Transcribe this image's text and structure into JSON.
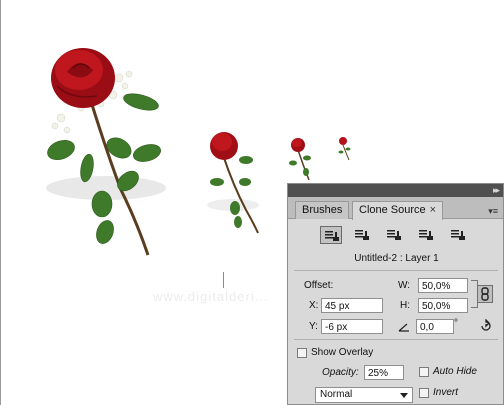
{
  "canvas": {
    "watermark": "www.digitalderi..."
  },
  "panel": {
    "tabs": [
      {
        "label": "Brushes",
        "active": false
      },
      {
        "label": "Clone Source",
        "active": true
      }
    ],
    "tab_close": "×",
    "collapse_glyph": "▸▸",
    "menu_glyph": "▾≡",
    "clone_sources": [
      "clone-source-1",
      "clone-source-2",
      "clone-source-3",
      "clone-source-4",
      "clone-source-5"
    ],
    "document_label": "Untitled-2 : Layer 1",
    "offset_label": "Offset:",
    "x_label": "X:",
    "x_value": "45 px",
    "y_label": "Y:",
    "y_value": "-6 px",
    "w_label": "W:",
    "w_value": "50,0%",
    "h_label": "H:",
    "h_value": "50,0%",
    "angle_value": "0,0",
    "angle_unit": "°",
    "show_overlay_label": "Show Overlay",
    "show_overlay_checked": false,
    "opacity_label": "Opacity:",
    "opacity_value": "25%",
    "auto_hide_label": "Auto Hide",
    "auto_hide_checked": false,
    "invert_label": "Invert",
    "invert_checked": false,
    "blend_mode": "Normal"
  },
  "colors": {
    "rose_red": "#b3121a",
    "leaf_green": "#3f7a2a",
    "panel_bg": "#d9d9d9"
  }
}
